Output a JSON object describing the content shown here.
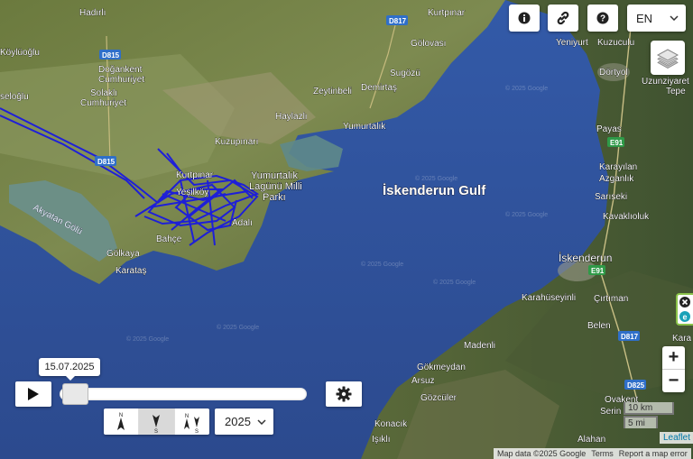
{
  "toolbar": {
    "info_icon": "info-icon",
    "link_icon": "link-icon",
    "help_icon": "help-icon",
    "language": "EN"
  },
  "map": {
    "gulf_label": "İskenderun Gulf",
    "park_label_1": "Yumurtalık",
    "park_label_2": "Lagünü Milli",
    "park_label_3": "Parkı",
    "lake_label": "Akyatan Gölü",
    "places": {
      "hadirli": "Hadırlı",
      "koyluoglu": "Köylüoğlu",
      "dogankent": "Doğankent",
      "cumhuriyet1": "Cumhuriyet",
      "solakli": "Solaklı",
      "cumhuriyet2": "Cumhuriyet",
      "seloglu": "seloğlu",
      "kurtpinar": "Kurtpınar",
      "golovasi": "Gölovası",
      "sugozu": "Sugözü",
      "zeytinbeli": "Zeytinbeli",
      "demirtas": "Demirtaş",
      "haylazli": "Haylazlı",
      "yumurtalik": "Yumurtalık",
      "kuzupinari": "Kuzupınarı",
      "kurtpinar2": "Kurtpınar",
      "yesilkoy": "Yeşilköy",
      "adali": "Adalı",
      "bahce": "Bahçe",
      "golkaya": "Gölkaya",
      "karatas": "Karataş",
      "yeniyurt": "Yeniyurt",
      "kuzuculu": "Kuzuculu",
      "dortyol": "Dörtyol",
      "uzunziyaret": "Uzunziyaret",
      "tepe": "Tepe",
      "payas": "Payas",
      "karayilan": "Karayılan",
      "azganlik": "Azganlık",
      "sariseki": "Sarıseki",
      "kavaklioluk": "Kavaklıoluk",
      "iskenderun": "İskenderun",
      "karahuseyinli": "Karahüseyinli",
      "cirtiman": "Çırtıman",
      "belen": "Belen",
      "madenli": "Madenli",
      "kara": "Kara",
      "gokmeydan": "Gökmeydan",
      "arsuz": "Arsuz",
      "gozculer": "Gözcüler",
      "ovakent": "Ovakent",
      "serin": "Serin",
      "konacik": "Konacık",
      "isikli": "Işıklı",
      "alahan": "Alahan"
    },
    "roads": {
      "d817_top": "D817",
      "d815_a": "D815",
      "d815_b": "D815",
      "e91_a": "E91",
      "e91_b": "E91",
      "d817_b": "D817",
      "d825": "D825"
    },
    "watermark": "© 2025 Google",
    "layers_icon": "layers-icon",
    "zoom_in": "+",
    "zoom_out": "−",
    "scale_km": "10 km",
    "scale_mi": "5 mi"
  },
  "attribution": {
    "leaflet": "Leaflet",
    "map_data": "Map data ©2025 Google",
    "terms": "Terms",
    "report": "Report a map error"
  },
  "timeline": {
    "date": "15.07.2025",
    "year": "2025",
    "position": 0.02,
    "north_up_label": "N",
    "south_label": "S"
  },
  "colors": {
    "track": "#1a1adf",
    "sea": "#2e4f9a"
  }
}
